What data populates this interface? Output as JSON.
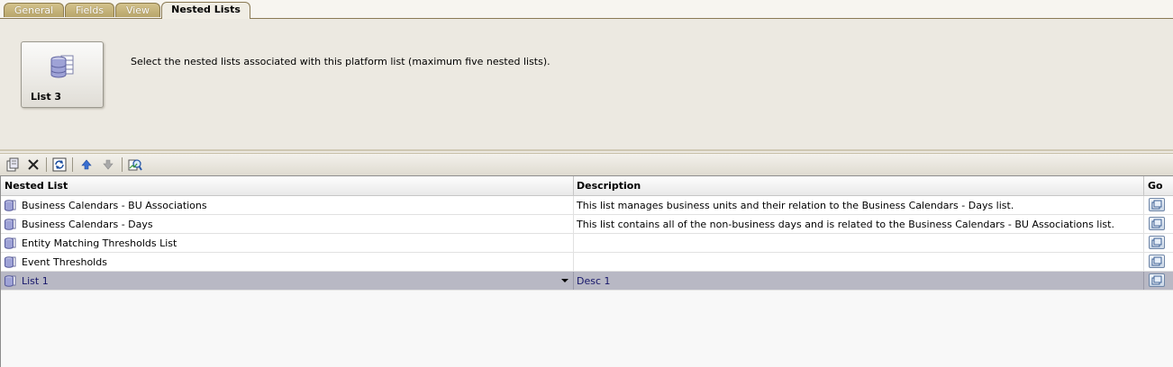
{
  "tabs": [
    {
      "label": "General",
      "active": false
    },
    {
      "label": "Fields",
      "active": false
    },
    {
      "label": "View",
      "active": false
    },
    {
      "label": "Nested Lists",
      "active": true
    }
  ],
  "header": {
    "tile_label": "List 3",
    "tile_icon": "database-icon",
    "description": "Select the nested lists associated with this platform list (maximum five nested lists)."
  },
  "toolbar": {
    "icons": [
      "new-item-icon",
      "delete-icon",
      "refresh-icon",
      "move-up-icon",
      "move-down-icon",
      "lookup-icon"
    ]
  },
  "grid": {
    "columns": [
      "Nested List",
      "Description",
      "Go"
    ],
    "rows": [
      {
        "name": "Business Calendars - BU Associations",
        "description": "This list manages business units and their relation to the Business Calendars - Days list.",
        "selected": false
      },
      {
        "name": "Business Calendars - Days",
        "description": "This list contains all of the non-business days and is related to the Business Calendars - BU Associations list.",
        "selected": false
      },
      {
        "name": "Entity Matching Thresholds List",
        "description": "",
        "selected": false
      },
      {
        "name": "Event Thresholds",
        "description": "",
        "selected": false
      },
      {
        "name": "List 1",
        "description": "Desc 1",
        "selected": true
      }
    ]
  },
  "colors": {
    "tab_inactive": "#c4b27a",
    "selected_row": "#b8b8c4",
    "selected_text": "#16166a"
  }
}
